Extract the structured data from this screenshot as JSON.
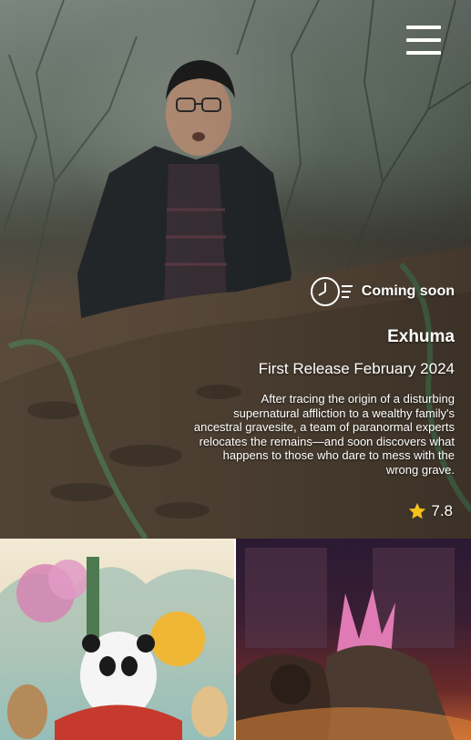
{
  "header": {
    "menu_icon": "hamburger-menu-icon"
  },
  "featured": {
    "status_icon": "clock-fast-icon",
    "status_label": "Coming soon",
    "title": "Exhuma",
    "release": "First Release February 2024",
    "synopsis": "After tracing the origin of a disturbing supernatural affliction to a wealthy family's ancestral gravesite, a team of paranormal experts relocates the remains—and soon discovers what happens to those who dare to mess with the wrong grave.",
    "rating_icon": "star-icon",
    "rating": "7.8",
    "accent_color": "#f5c21b"
  },
  "posters": [
    {
      "name": "kung-fu-panda-poster",
      "icon": "panda-poster-art"
    },
    {
      "name": "godzilla-kong-poster",
      "icon": "monster-poster-art"
    }
  ]
}
